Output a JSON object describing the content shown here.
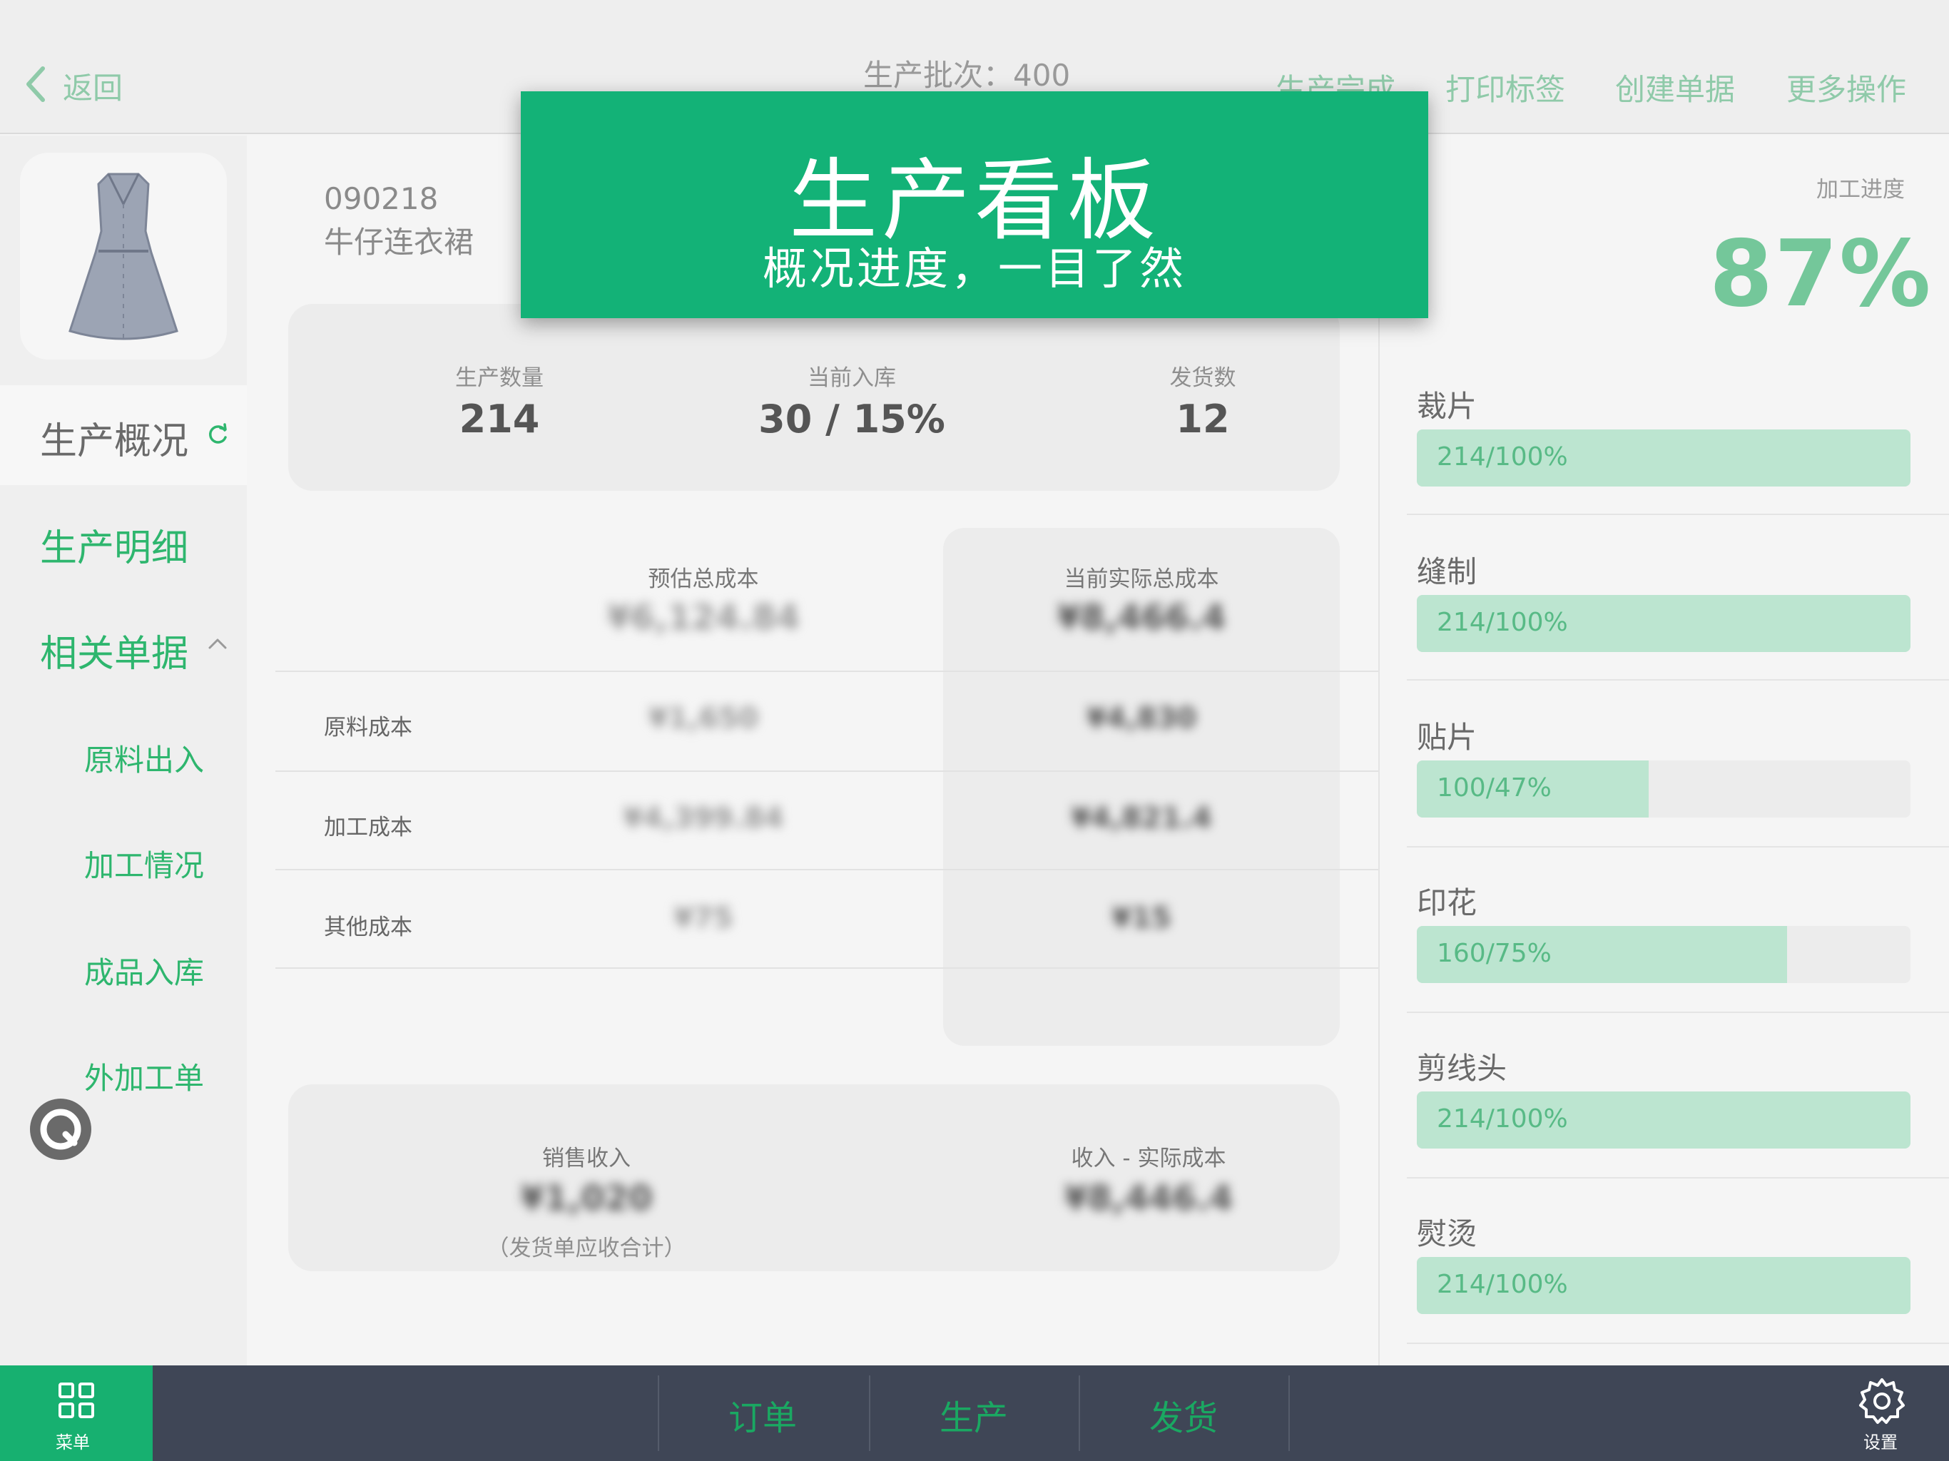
{
  "header": {
    "back_label": "返回",
    "batch_label": "生产批次：400",
    "actions": [
      "生产完成",
      "打印标签",
      "创建单据",
      "更多操作"
    ]
  },
  "product": {
    "code": "090218",
    "name": "牛仔连衣裙"
  },
  "sidebar": {
    "overview": "生产概况",
    "detail": "生产明细",
    "related_docs": "相关单据",
    "sub_items": [
      "原料出入",
      "加工情况",
      "成品入库",
      "外加工单"
    ]
  },
  "summary": {
    "quantity_label": "生产数量",
    "quantity_value": "214",
    "stock_label": "当前入库",
    "stock_value": "30 / 15%",
    "shipped_label": "发货数",
    "shipped_value": "12"
  },
  "costs": {
    "estimated_header": "预估总成本",
    "actual_header": "当前实际总成本",
    "estimated_total": "¥6,124.84",
    "actual_total": "¥8,466.4",
    "rows": [
      {
        "label": "原料成本",
        "estimated": "¥1,650",
        "actual": "¥4,830"
      },
      {
        "label": "加工成本",
        "estimated": "¥4,399.84",
        "actual": "¥4,821.4"
      },
      {
        "label": "其他成本",
        "estimated": "¥75",
        "actual": "¥15"
      }
    ]
  },
  "revenue": {
    "sales_label": "销售收入",
    "sales_value": "¥1,020",
    "sales_note": "（发货单应收合计）",
    "profit_label": "收入 - 实际成本",
    "profit_value": "¥8,446.4"
  },
  "progress": {
    "label": "加工进度",
    "percent": "87%",
    "processes": [
      {
        "name": "裁片",
        "text": "214/100%",
        "fraction": 1.0
      },
      {
        "name": "缝制",
        "text": "214/100%",
        "fraction": 1.0
      },
      {
        "name": "贴片",
        "text": "100/47%",
        "fraction": 0.47
      },
      {
        "name": "印花",
        "text": "160/75%",
        "fraction": 0.75
      },
      {
        "name": "剪线头",
        "text": "214/100%",
        "fraction": 1.0
      },
      {
        "name": "熨烫",
        "text": "214/100%",
        "fraction": 1.0
      }
    ]
  },
  "bottom": {
    "menu_label": "菜单",
    "tabs": [
      "订单",
      "生产",
      "发货"
    ],
    "settings_label": "设置"
  },
  "banner": {
    "title": "生产看板",
    "subtitle": "概况进度，一目了然"
  },
  "colors": {
    "brand_green": "#13b277",
    "bar_fill": "#bce5d0",
    "bottom_bar": "#3f4656"
  }
}
